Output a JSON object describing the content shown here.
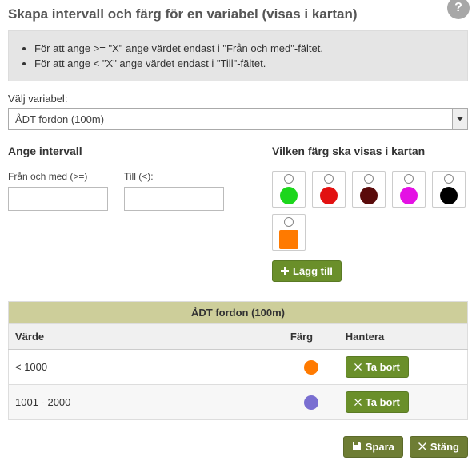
{
  "header": {
    "title": "Skapa intervall och färg för en variabel (visas i kartan)",
    "help_icon": "?"
  },
  "info": {
    "line1": "För att ange >= \"X\" ange värdet endast i \"Från och med\"-fältet.",
    "line2": "För att ange < \"X\" ange värdet endast i \"Till\"-fältet."
  },
  "variable": {
    "label": "Välj variabel:",
    "selected": "ÅDT fordon (100m)"
  },
  "interval": {
    "title": "Ange intervall",
    "from_label": "Från och med (>=)",
    "to_label": "Till (<):",
    "from_value": "",
    "to_value": ""
  },
  "colors": {
    "title": "Vilken färg ska visas i kartan",
    "options": [
      {
        "name": "green",
        "hex": "#1cd61c",
        "shape": "circle"
      },
      {
        "name": "red",
        "hex": "#e21111",
        "shape": "circle"
      },
      {
        "name": "darkred",
        "hex": "#5a0b0b",
        "shape": "circle"
      },
      {
        "name": "magenta",
        "hex": "#e411e4",
        "shape": "circle"
      },
      {
        "name": "black",
        "hex": "#000000",
        "shape": "circle"
      },
      {
        "name": "orange",
        "hex": "#ff7a00",
        "shape": "square"
      }
    ],
    "add_button": "Lägg till"
  },
  "table": {
    "title": "ÅDT fordon (100m)",
    "headers": {
      "value": "Värde",
      "color": "Färg",
      "manage": "Hantera"
    },
    "rows": [
      {
        "value": "< 1000",
        "color": "#ff7a00"
      },
      {
        "value": "1001 - 2000",
        "color": "#7a6fd1"
      }
    ],
    "remove_button": "Ta bort"
  },
  "footer": {
    "save": "Spara",
    "close": "Stäng"
  }
}
